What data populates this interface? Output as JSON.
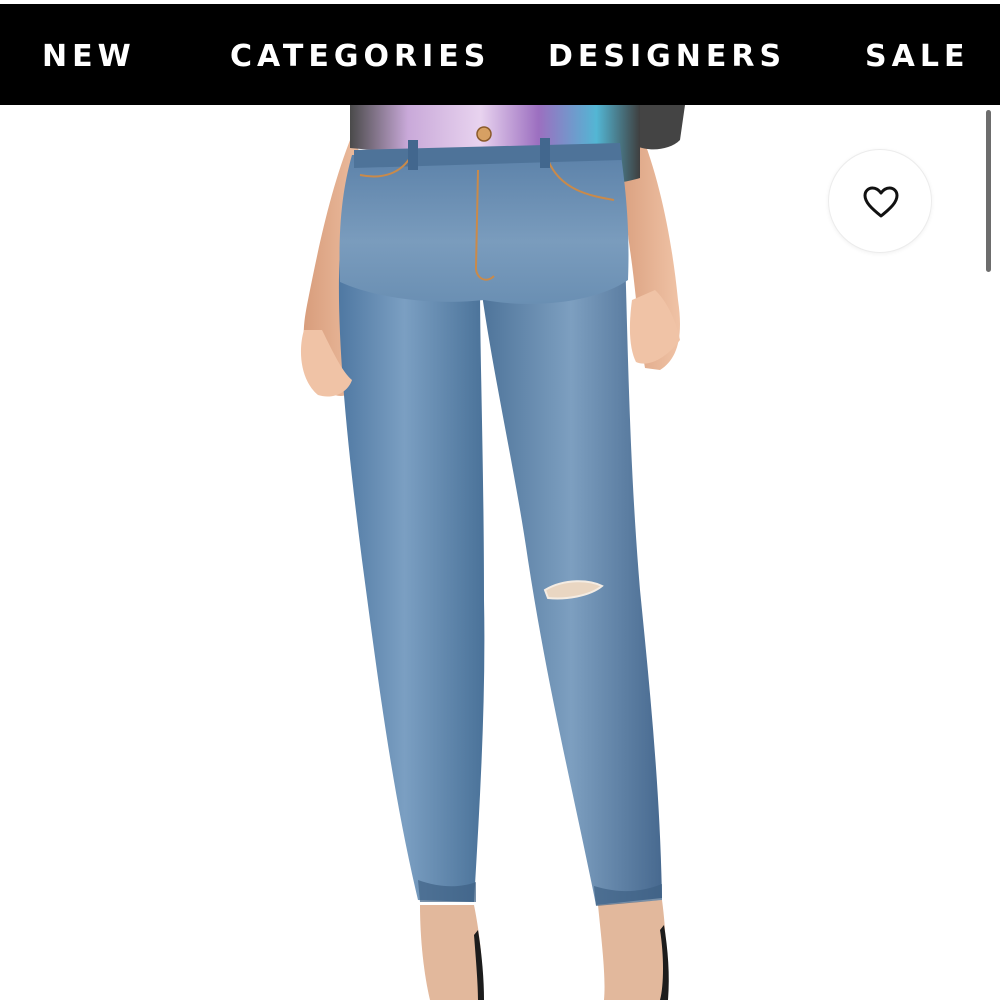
{
  "nav": {
    "items": [
      {
        "label": "NEW"
      },
      {
        "label": "CATEGORIES"
      },
      {
        "label": "DESIGNERS"
      },
      {
        "label": "SALE"
      }
    ]
  },
  "product": {
    "image_icon": "product-photo-high-rise-skinny-jeans",
    "favorite_icon": "heart-outline-icon"
  },
  "colors": {
    "nav_background": "#000000",
    "nav_text": "#ffffff",
    "denim": "#5f86ad"
  }
}
